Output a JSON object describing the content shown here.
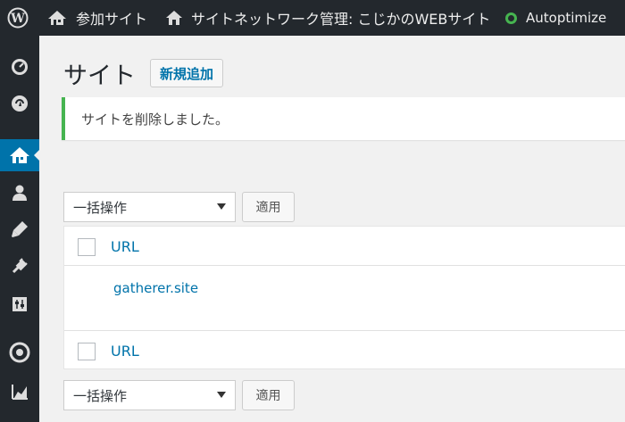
{
  "adminbar": {
    "wp_logo_icon": "wordpress-logo-icon",
    "my_sites_label": "参加サイト",
    "network_admin_label": "サイトネットワーク管理: こじかのWEBサイト",
    "plugin_label": "Autoptimize",
    "plugin_status_color": "#46b450"
  },
  "sidebar": {
    "items": [
      {
        "icon": "dashboard-icon"
      },
      {
        "icon": "updates-icon"
      },
      {
        "icon": "sites-icon",
        "current": true
      },
      {
        "icon": "users-icon"
      },
      {
        "icon": "themes-icon"
      },
      {
        "icon": "plugins-icon"
      },
      {
        "icon": "settings-icon"
      },
      {
        "icon": "collapse-icon"
      },
      {
        "icon": "stats-icon"
      }
    ]
  },
  "main": {
    "title": "サイト",
    "add_new_label": "新規追加",
    "notice_text": "サイトを削除しました。",
    "bulk_top": {
      "selected": "一括操作",
      "apply_label": "適用"
    },
    "bulk_bottom": {
      "selected": "一括操作",
      "apply_label": "適用"
    },
    "table": {
      "column_header": "URL",
      "rows": [
        {
          "url": "gatherer.site"
        }
      ],
      "column_footer": "URL"
    }
  },
  "colors": {
    "accent": "#0073aa",
    "adminbar_bg": "#23282d",
    "notice_success": "#46b450"
  }
}
